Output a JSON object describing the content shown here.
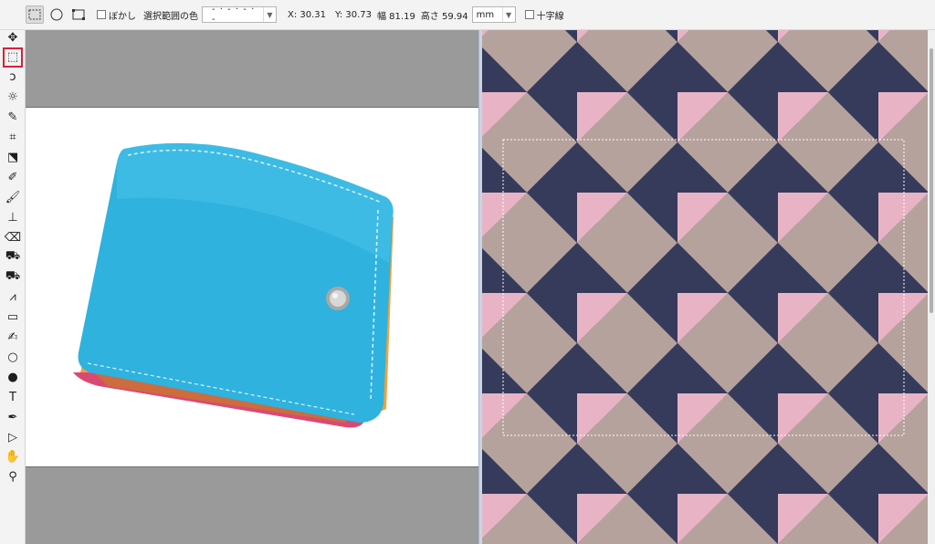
{
  "options_bar": {
    "selection_modes": [
      {
        "name": "rectangle-select-mode-icon",
        "active": true
      },
      {
        "name": "ellipse-select-mode-icon",
        "active": false
      },
      {
        "name": "polygon-select-mode-icon",
        "active": false
      }
    ],
    "feather_label": "ぼかし",
    "selection_color_label": "選択範囲の色",
    "selection_color_value": "- · - · - · -",
    "x_readout": "X: 30.31",
    "y_readout": "Y: 30.73",
    "width_readout": "幅 81.19",
    "height_readout": "高さ 59.94",
    "unit_value": "mm",
    "crosshair_label": "十字線"
  },
  "toolbar": {
    "tools": [
      {
        "name": "move-tool-icon",
        "glyph": "✥",
        "active": false
      },
      {
        "name": "rectangle-select-tool-icon",
        "glyph": "⬚",
        "active": true
      },
      {
        "name": "lasso-tool-icon",
        "glyph": "ↄ",
        "active": false
      },
      {
        "name": "magic-select-tool-icon",
        "glyph": "☼",
        "active": false
      },
      {
        "name": "pen-select-tool-icon",
        "glyph": "✎",
        "active": false
      },
      {
        "name": "crop-tool-icon",
        "glyph": "⌗",
        "active": false
      },
      {
        "name": "transform-tool-icon",
        "glyph": "⬔",
        "active": false
      },
      {
        "name": "eyedropper-tool-icon",
        "glyph": "✐",
        "active": false
      },
      {
        "name": "brush-tool-icon",
        "glyph": "🖌",
        "active": false
      },
      {
        "name": "stamp-tool-icon",
        "glyph": "⊥",
        "active": false
      },
      {
        "name": "eraser-tool-icon",
        "glyph": "⌫",
        "active": false
      },
      {
        "name": "bucket-tool-icon",
        "glyph": "⛟",
        "active": false
      },
      {
        "name": "bucket-fill-tool-icon",
        "glyph": "⛟",
        "active": false
      },
      {
        "name": "pattern-tool-icon",
        "glyph": "⩘",
        "active": false
      },
      {
        "name": "shape-tool-icon",
        "glyph": "▭",
        "active": false
      },
      {
        "name": "blur-tool-icon",
        "glyph": "✍",
        "active": false
      },
      {
        "name": "drop-tool-icon",
        "glyph": "○",
        "active": false
      },
      {
        "name": "dodge-tool-icon",
        "glyph": "●",
        "active": false
      },
      {
        "name": "text-tool-icon",
        "glyph": "T",
        "active": false
      },
      {
        "name": "pen-tool-icon",
        "glyph": "✒",
        "active": false
      },
      {
        "name": "direct-select-tool-icon",
        "glyph": "▷",
        "active": false
      },
      {
        "name": "hand-tool-icon",
        "glyph": "✋",
        "active": false
      },
      {
        "name": "zoom-tool-icon",
        "glyph": "⚲",
        "active": false
      }
    ]
  },
  "colors": {
    "navy": "#363b5c",
    "taupe": "#b6a29c",
    "pink": "#e8b4c5",
    "wallet_blue": "#2fb2de",
    "wallet_orange": "#f2a03a",
    "accent_red": "#d6213a"
  }
}
